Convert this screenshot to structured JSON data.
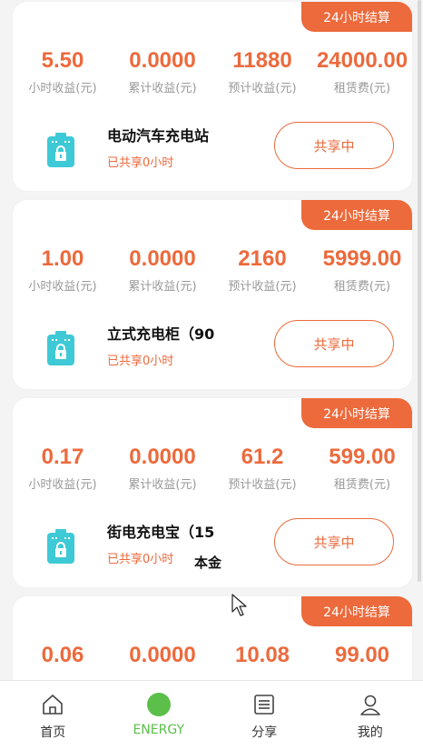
{
  "badge_label": "24小时结算",
  "share_button_label": "共享中",
  "stat_labels": [
    "小时收益(元)",
    "累计收益(元)",
    "预计收益(元)",
    "租赁费(元)"
  ],
  "cards": [
    {
      "values": [
        "5.50",
        "0.0000",
        "11880",
        "24000.00"
      ],
      "name": "电动汽车充电站",
      "shared": "已共享0小时"
    },
    {
      "values": [
        "1.00",
        "0.0000",
        "2160",
        "5999.00"
      ],
      "name": "立式充电柜（90",
      "shared": "已共享0小时"
    },
    {
      "values": [
        "0.17",
        "0.0000",
        "61.2",
        "599.00"
      ],
      "name": "街电充电宝（15",
      "shared": "已共享0小时",
      "overlay": "本金"
    },
    {
      "values": [
        "0.06",
        "0.0000",
        "10.08",
        "99.00"
      ],
      "name": "",
      "shared": ""
    }
  ],
  "tabs": [
    {
      "label": "首页",
      "icon": "home-icon"
    },
    {
      "label": "ENERGY",
      "icon": "energy-dot-icon"
    },
    {
      "label": "分享",
      "icon": "share-list-icon"
    },
    {
      "label": "我的",
      "icon": "user-icon"
    }
  ],
  "colors": {
    "accent": "#ec6a3c",
    "device_icon": "#3ec9d6",
    "energy_active": "#5bbf4a"
  }
}
